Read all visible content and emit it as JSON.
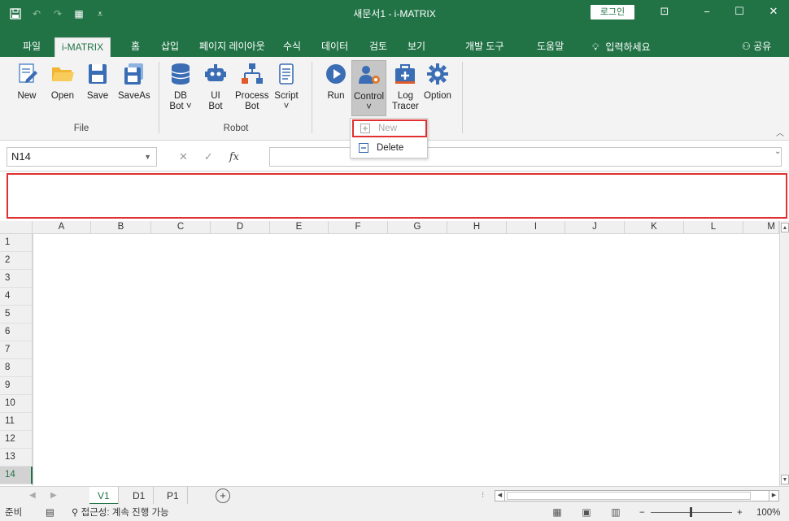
{
  "titlebar": {
    "title": "새문서1  -  i-MATRIX",
    "login": "로그인",
    "qat_save_icon": "save-icon",
    "colors": {
      "brand": "#217346"
    }
  },
  "tabs": [
    {
      "label": "파일"
    },
    {
      "label": "i-MATRIX"
    },
    {
      "label": "홈"
    },
    {
      "label": "삽입"
    },
    {
      "label": "페이지 레이아웃"
    },
    {
      "label": "수식"
    },
    {
      "label": "데이터"
    },
    {
      "label": "검토"
    },
    {
      "label": "보기"
    },
    {
      "label": "개발 도구"
    },
    {
      "label": "도움말"
    }
  ],
  "tellme": "입력하세요",
  "share": "공유",
  "ribbon": {
    "file_group": {
      "label": "File",
      "buttons": [
        {
          "label": "New"
        },
        {
          "label": "Open"
        },
        {
          "label": "Save"
        },
        {
          "label": "SaveAs"
        }
      ]
    },
    "robot_group": {
      "label": "Robot",
      "buttons": [
        {
          "label": "DB",
          "label2": "Bot ˅"
        },
        {
          "label": "UI",
          "label2": "Bot"
        },
        {
          "label": "Process",
          "label2": "Bot"
        },
        {
          "label": "Script",
          "label2": "˅"
        }
      ]
    },
    "run_group": {
      "buttons": [
        {
          "label": "Run"
        },
        {
          "label": "Control",
          "label2": "˅"
        },
        {
          "label": "Log",
          "label2": "Tracer"
        },
        {
          "label": "Option"
        }
      ]
    }
  },
  "dropdown": {
    "items": [
      {
        "label": "New",
        "disabled": true
      },
      {
        "label": "Delete",
        "disabled": false
      }
    ]
  },
  "formula_bar": {
    "name_box": "N14",
    "fx": "fx",
    "value": ""
  },
  "grid": {
    "columns": [
      "A",
      "B",
      "C",
      "D",
      "E",
      "F",
      "G",
      "H",
      "I",
      "J",
      "K",
      "L",
      "M"
    ],
    "rows": [
      "1",
      "2",
      "3",
      "4",
      "5",
      "6",
      "7",
      "8",
      "9",
      "10",
      "11",
      "12",
      "13",
      "14"
    ]
  },
  "sheets": [
    {
      "label": "V1",
      "active": true
    },
    {
      "label": "D1",
      "active": false
    },
    {
      "label": "P1",
      "active": false
    }
  ],
  "statusbar": {
    "ready": "준비",
    "accessibility": "접근성: 계속 진행 가능",
    "zoom": "100%",
    "minus": "−",
    "plus": "+"
  }
}
